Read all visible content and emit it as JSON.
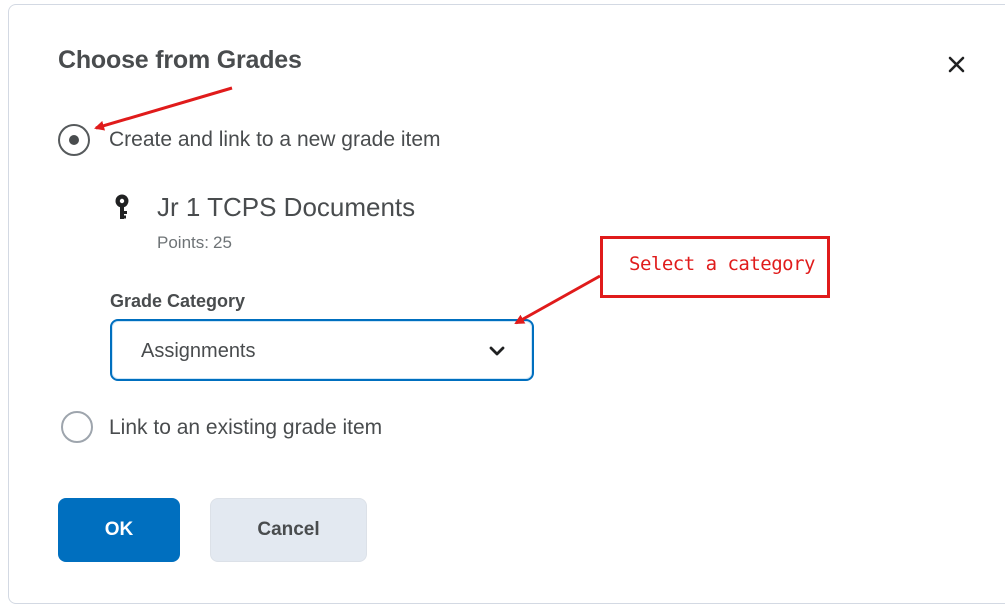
{
  "dialog": {
    "title": "Choose from Grades",
    "close_icon": "close-icon"
  },
  "options": {
    "create_new": {
      "label": "Create and link to a new grade item",
      "checked": true
    },
    "link_existing": {
      "label": "Link to an existing grade item",
      "checked": false
    }
  },
  "grade_item": {
    "icon": "grade-item-icon",
    "name": "Jr 1 TCPS Documents",
    "points_label": "Points:",
    "points_value": "25"
  },
  "grade_category": {
    "label": "Grade Category",
    "selected": "Assignments"
  },
  "buttons": {
    "ok": "OK",
    "cancel": "Cancel"
  },
  "annotation": {
    "text": "Select a category",
    "color": "#e01b1b"
  },
  "colors": {
    "primary": "#006fbf",
    "text": "#494c4e"
  }
}
